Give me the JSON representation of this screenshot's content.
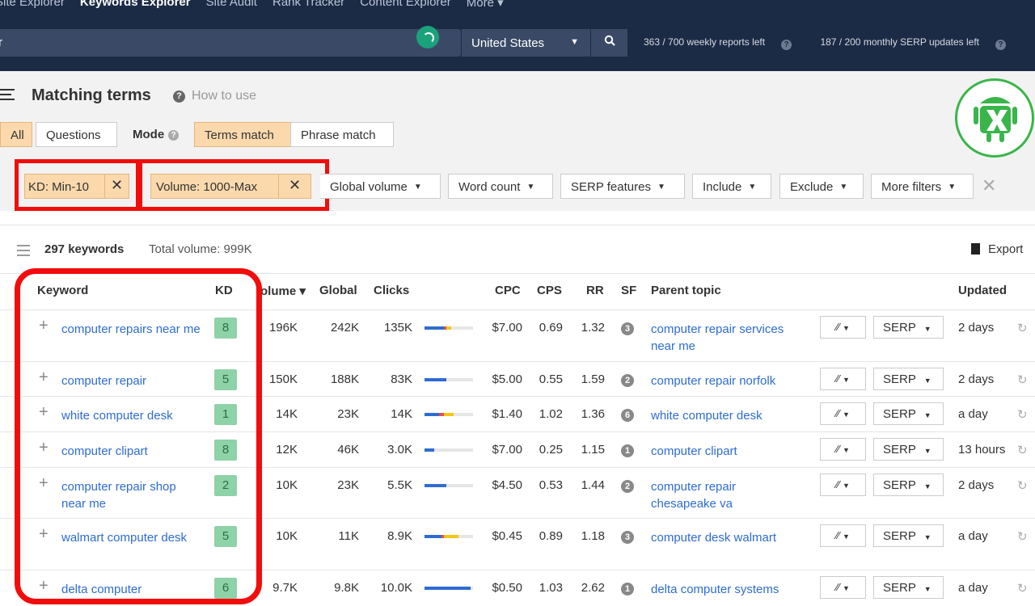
{
  "topnav": {
    "items": [
      {
        "label": "Site Explorer",
        "active": false
      },
      {
        "label": "Keywords Explorer",
        "active": true
      },
      {
        "label": "Site Audit",
        "active": false
      },
      {
        "label": "Rank Tracker",
        "active": false
      },
      {
        "label": "Content Explorer",
        "active": false
      },
      {
        "label": "More ▾",
        "active": false
      }
    ]
  },
  "search": {
    "value": "r",
    "country": "United States",
    "weekly_reports": "363 / 700 weekly reports left",
    "monthly_serp": "187 / 200 monthly SERP updates left"
  },
  "header": {
    "title": "Matching terms",
    "how_to_use": "How to use",
    "tabs": [
      "All",
      "Questions"
    ],
    "mode_label": "Mode",
    "modes": [
      "Terms match",
      "Phrase match"
    ]
  },
  "filters": {
    "kd_chip": "KD: Min-10",
    "volume_chip": "Volume: 1000-Max",
    "dropdowns": [
      "Global volume",
      "Word count",
      "SERP features",
      "Include",
      "Exclude",
      "More filters"
    ]
  },
  "summary": {
    "count": "297 keywords",
    "total_volume": "Total volume: 999K",
    "export": "Export"
  },
  "columns": {
    "keyword": "Keyword",
    "kd": "KD",
    "volume": "olume ▾",
    "global": "Global",
    "clicks": "Clicks",
    "cpc": "CPC",
    "cps": "CPS",
    "rr": "RR",
    "sf": "SF",
    "parent": "Parent topic",
    "updated": "Updated"
  },
  "rows": [
    {
      "keyword": "computer repairs near me",
      "kd": "8",
      "volume": "196K",
      "global": "242K",
      "clicks": "135K",
      "click_split": [
        0.4,
        0.05,
        0.1
      ],
      "cpc": "$7.00",
      "cps": "0.69",
      "rr": "1.32",
      "sf": "3",
      "parent": "computer repair services near me",
      "serp": "SERP",
      "updated": "2 days"
    },
    {
      "keyword": "computer repair",
      "kd": "5",
      "volume": "150K",
      "global": "188K",
      "clicks": "83K",
      "click_split": [
        0.45,
        0.0,
        0.0
      ],
      "cpc": "$5.00",
      "cps": "0.55",
      "rr": "1.59",
      "sf": "2",
      "parent": "computer repair norfolk",
      "serp": "SERP",
      "updated": "2 days"
    },
    {
      "keyword": "white computer desk",
      "kd": "1",
      "volume": "14K",
      "global": "23K",
      "clicks": "14K",
      "click_split": [
        0.3,
        0.1,
        0.2
      ],
      "cpc": "$1.40",
      "cps": "1.02",
      "rr": "1.36",
      "sf": "6",
      "parent": "white computer desk",
      "serp": "SERP",
      "updated": "a day"
    },
    {
      "keyword": "computer clipart",
      "kd": "8",
      "volume": "12K",
      "global": "46K",
      "clicks": "3.0K",
      "click_split": [
        0.2,
        0.0,
        0.0
      ],
      "cpc": "$7.00",
      "cps": "0.25",
      "rr": "1.15",
      "sf": "1",
      "parent": "computer clipart",
      "serp": "SERP",
      "updated": "13 hours"
    },
    {
      "keyword": "computer repair shop near me",
      "kd": "2",
      "volume": "10K",
      "global": "23K",
      "clicks": "5.5K",
      "click_split": [
        0.45,
        0.0,
        0.0
      ],
      "cpc": "$4.50",
      "cps": "0.53",
      "rr": "1.44",
      "sf": "2",
      "parent": "computer repair chesapeake va",
      "serp": "SERP",
      "updated": "2 days"
    },
    {
      "keyword": "walmart computer desk",
      "kd": "5",
      "volume": "10K",
      "global": "11K",
      "clicks": "8.9K",
      "click_split": [
        0.35,
        0.05,
        0.3
      ],
      "cpc": "$0.45",
      "cps": "0.89",
      "rr": "1.18",
      "sf": "3",
      "parent": "computer desk walmart",
      "serp": "SERP",
      "updated": "a day"
    },
    {
      "keyword": "delta computer",
      "kd": "6",
      "volume": "9.7K",
      "global": "9.8K",
      "clicks": "10.0K",
      "click_split": [
        0.95,
        0.0,
        0.0
      ],
      "cpc": "$0.50",
      "cps": "1.03",
      "rr": "2.62",
      "sf": "1",
      "parent": "delta computer systems",
      "serp": "SERP",
      "updated": "a day"
    }
  ],
  "colors": {
    "nav_bg": "#1c2b45",
    "accent_chip": "#fbd9ac",
    "kd_green": "#8ed2a7",
    "link_blue": "#2e6cd1",
    "highlight_red": "#f20d0d",
    "bar_blue": "#2e6cd1",
    "bar_red": "#e05050",
    "bar_yellow": "#f5c518"
  }
}
